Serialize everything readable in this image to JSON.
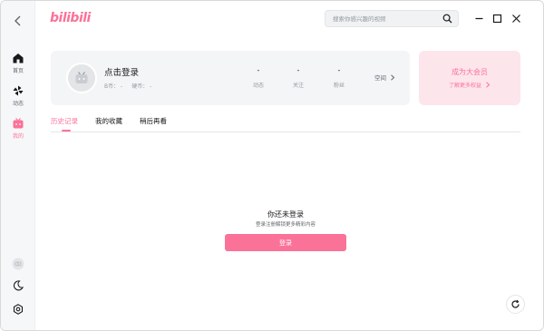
{
  "app": {
    "logo": "bilibili",
    "accent": "#fb7299"
  },
  "sidebar": {
    "items": [
      {
        "label": "首页",
        "icon": "home-icon"
      },
      {
        "label": "动态",
        "icon": "pinwheel-icon"
      },
      {
        "label": "我的",
        "icon": "tv-icon",
        "active": true
      }
    ],
    "bottom": [
      "user-avatar-icon",
      "moon-icon",
      "settings-icon"
    ]
  },
  "search": {
    "placeholder": "搜索你感兴趣的视频"
  },
  "profile": {
    "name": "点击登录",
    "b_coin": "B币： -",
    "coin": "硬币： -",
    "stats": [
      {
        "value": "-",
        "label": "动态"
      },
      {
        "value": "-",
        "label": "关注"
      },
      {
        "value": "-",
        "label": "粉丝"
      }
    ],
    "space_link": "空间"
  },
  "vip": {
    "title": "成为大会员",
    "link": "了解更多权益"
  },
  "tabs": [
    {
      "label": "历史记录",
      "active": true
    },
    {
      "label": "我的收藏"
    },
    {
      "label": "稍后再看"
    }
  ],
  "empty": {
    "title": "你还未登录",
    "subtitle": "登录注册解锁更多精彩内容",
    "button": "登录"
  }
}
